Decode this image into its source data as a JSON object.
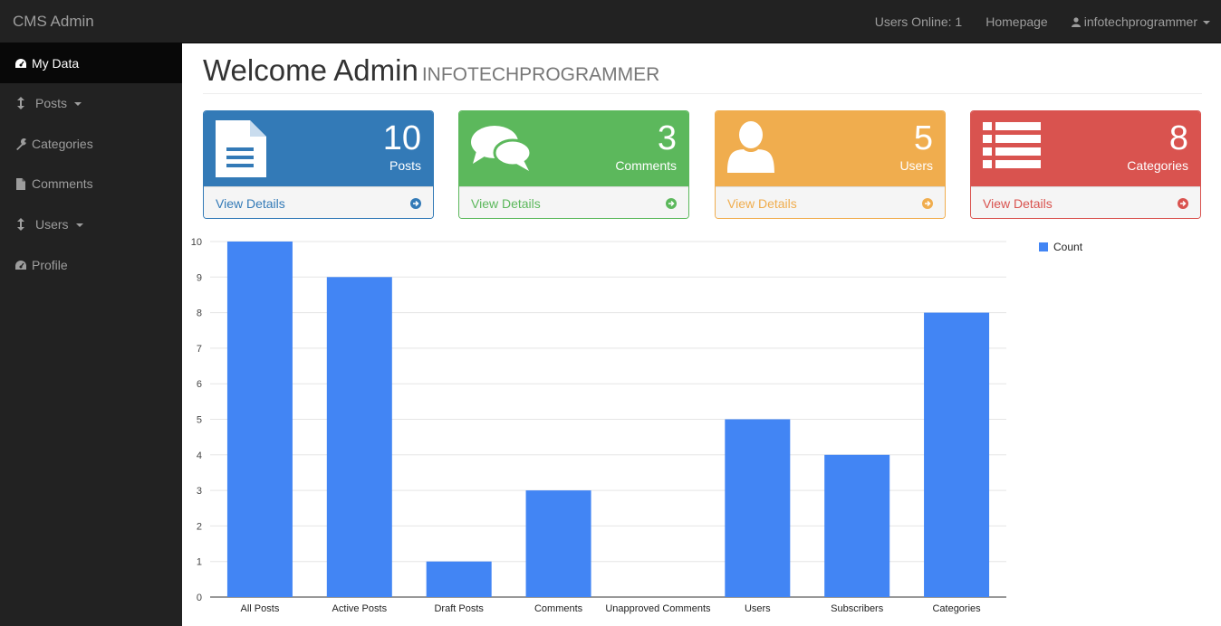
{
  "navbar": {
    "brand": "CMS Admin",
    "users_online": "Users Online: 1",
    "homepage": "Homepage",
    "username": "infotechprogrammer"
  },
  "sidebar": {
    "items": [
      {
        "label": "My Data",
        "icon": "dashboard-icon",
        "active": true
      },
      {
        "label": "Posts",
        "icon": "arrows-v-icon",
        "dropdown": true
      },
      {
        "label": "Categories",
        "icon": "wrench-icon"
      },
      {
        "label": "Comments",
        "icon": "file-icon"
      },
      {
        "label": "Users",
        "icon": "arrows-v-icon",
        "dropdown": true
      },
      {
        "label": "Profile",
        "icon": "dashboard-icon"
      }
    ]
  },
  "header": {
    "title": "Welcome Admin",
    "subtitle": "INFOTECHPROGRAMMER"
  },
  "panels": [
    {
      "count": "10",
      "label": "Posts",
      "link": "View Details",
      "color": "#337ab7",
      "icon": "file-text-icon"
    },
    {
      "count": "3",
      "label": "Comments",
      "link": "View Details",
      "color": "#5cb85c",
      "icon": "comments-icon"
    },
    {
      "count": "5",
      "label": "Users",
      "link": "View Details",
      "color": "#f0ad4e",
      "icon": "user-icon"
    },
    {
      "count": "8",
      "label": "Categories",
      "link": "View Details",
      "color": "#d9534f",
      "icon": "list-icon"
    }
  ],
  "chart_data": {
    "type": "bar",
    "categories": [
      "All Posts",
      "Active Posts",
      "Draft Posts",
      "Comments",
      "Unapproved Comments",
      "Users",
      "Subscribers",
      "Categories"
    ],
    "series": [
      {
        "name": "Count",
        "values": [
          10,
          9,
          1,
          3,
          0,
          5,
          4,
          8
        ],
        "color": "#4285f4"
      }
    ],
    "ylim": [
      0,
      10
    ],
    "yticks": [
      0,
      1,
      2,
      3,
      4,
      5,
      6,
      7,
      8,
      9,
      10
    ],
    "legend": "right"
  }
}
